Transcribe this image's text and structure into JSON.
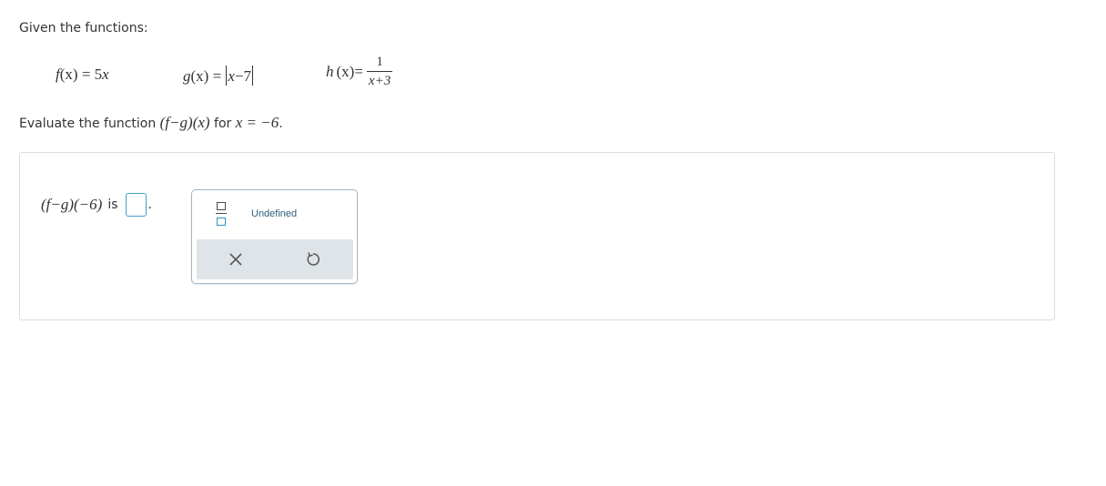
{
  "intro_text": "Given the functions:",
  "functions": {
    "f": {
      "name": "f",
      "var": "(x)",
      "eq": " = 5",
      "x": "x"
    },
    "g": {
      "name": "g",
      "var": "(x)",
      "eq": " = ",
      "inner_x": "x",
      "inner_rest": "−7"
    },
    "h": {
      "name": "h",
      "var": "(x)",
      "eq": " = ",
      "numerator": "1",
      "denominator": "x+3"
    }
  },
  "question": {
    "prefix": "Evaluate the function ",
    "expr": "(f−g)(x)",
    "middle": " for ",
    "condition": "x = −6",
    "suffix": "."
  },
  "answer": {
    "expr": "(f−g)(−6)",
    "is_label": "is",
    "value": "",
    "period": "."
  },
  "keypad": {
    "fraction_icon": "fraction-icon",
    "undefined_label": "Undefined",
    "clear_icon": "x-icon",
    "undo_icon": "undo-icon"
  },
  "colors": {
    "answer_box_border": "#3fa1c8",
    "keypad_border": "#9fb6c4",
    "keypad_bottom_bg": "#dfe4e8",
    "undefined_text": "#2d5f7a"
  }
}
